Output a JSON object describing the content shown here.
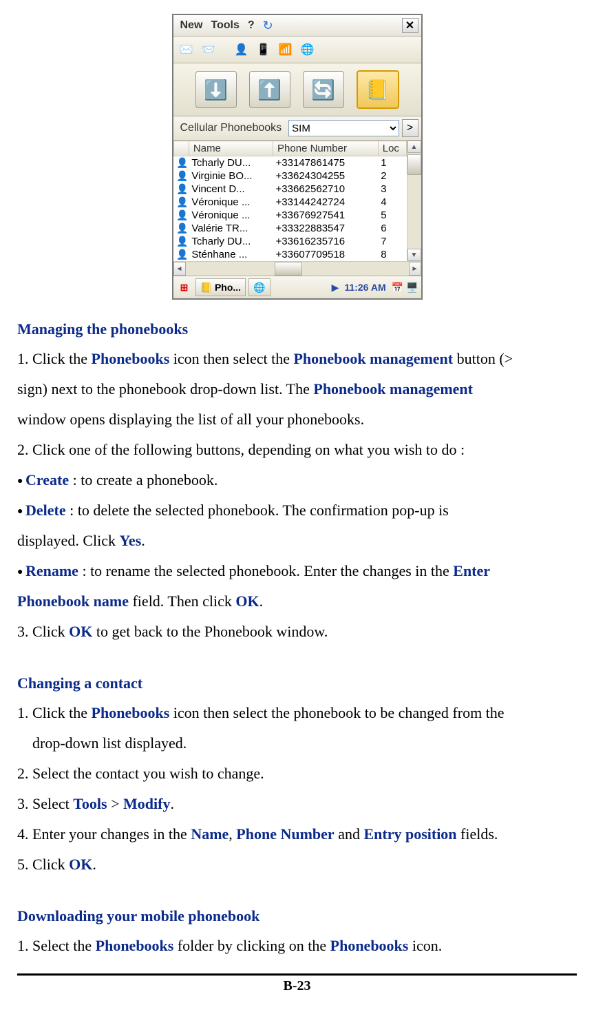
{
  "device": {
    "menu": {
      "new": "New",
      "tools": "Tools",
      "help": "?"
    },
    "selector": {
      "label": "Cellular Phonebooks",
      "value": "SIM",
      "mgmt": ">"
    },
    "columns": {
      "name": "Name",
      "phone": "Phone Number",
      "loc": "Loc"
    },
    "rows": [
      {
        "name": "Tcharly DU...",
        "phone": "+33147861475",
        "loc": "1"
      },
      {
        "name": "Virginie BO...",
        "phone": "+33624304255",
        "loc": "2"
      },
      {
        "name": "Vincent D...",
        "phone": "+33662562710",
        "loc": "3"
      },
      {
        "name": "Véronique ...",
        "phone": "+33144242724",
        "loc": "4"
      },
      {
        "name": "Véronique ...",
        "phone": "+33676927541",
        "loc": "5"
      },
      {
        "name": "Valérie TR...",
        "phone": "+33322883547",
        "loc": "6"
      },
      {
        "name": "Tcharly DU...",
        "phone": "+33616235716",
        "loc": "7"
      },
      {
        "name": "Sténhane ...",
        "phone": "+33607709518",
        "loc": "8"
      }
    ],
    "taskbar": {
      "app": "Pho...",
      "time": "11:26 AM"
    }
  },
  "sections": {
    "managing": {
      "title": "Managing the phonebooks",
      "step1_a": "1. Click the ",
      "step1_b": "Phonebooks",
      "step1_c": " icon then select the ",
      "step1_d": "Phonebook management",
      "step1_e": " button (> ",
      "step1_line2a": "sign) next to the phonebook drop-down list. The ",
      "step1_line2b": "Phonebook management",
      "step1_line3": "window opens displaying the list of all your phonebooks.",
      "step2": "2. Click one of the following buttons, depending on what you wish to do :",
      "b1_a": "Create",
      "b1_b": " : to create a phonebook.",
      "b2_a": "Delete",
      "b2_b": " : to delete the selected phonebook. The confirmation pop-up is ",
      "b2_line2a": "displayed. Click ",
      "b2_line2b": "Yes",
      "b2_line2c": ".",
      "b3_a": "Rename",
      "b3_b": " : to rename the selected phonebook. Enter the changes in the ",
      "b3_c": "Enter ",
      "b3_line2a": "Phonebook name",
      "b3_line2b": " field. Then click ",
      "b3_line2c": "OK",
      "b3_line2d": ".",
      "step3_a": "3. Click ",
      "step3_b": "OK",
      "step3_c": " to get back to the Phonebook window."
    },
    "changing": {
      "title": "Changing a contact",
      "s1_a": "1. Click the ",
      "s1_b": "Phonebooks",
      "s1_c": " icon then select the phonebook to be changed from the ",
      "s1_line2": "drop-down list displayed.",
      "s2": "2. Select the contact you wish to change.",
      "s3_a": "3. Select ",
      "s3_b": "Tools",
      "s3_c": " > ",
      "s3_d": "Modify",
      "s3_e": ".",
      "s4_a": "4. Enter your changes in the ",
      "s4_b": "Name",
      "s4_c": ", ",
      "s4_d": "Phone Number",
      "s4_e": " and ",
      "s4_f": "Entry position",
      "s4_g": " fields.",
      "s5_a": "5. Click ",
      "s5_b": "OK",
      "s5_c": "."
    },
    "downloading": {
      "title": "Downloading your mobile phonebook",
      "s1_a": "1. Select the ",
      "s1_b": "Phonebooks",
      "s1_c": " folder by clicking on the ",
      "s1_d": "Phonebooks",
      "s1_e": " icon."
    }
  },
  "page_number": "B-23"
}
